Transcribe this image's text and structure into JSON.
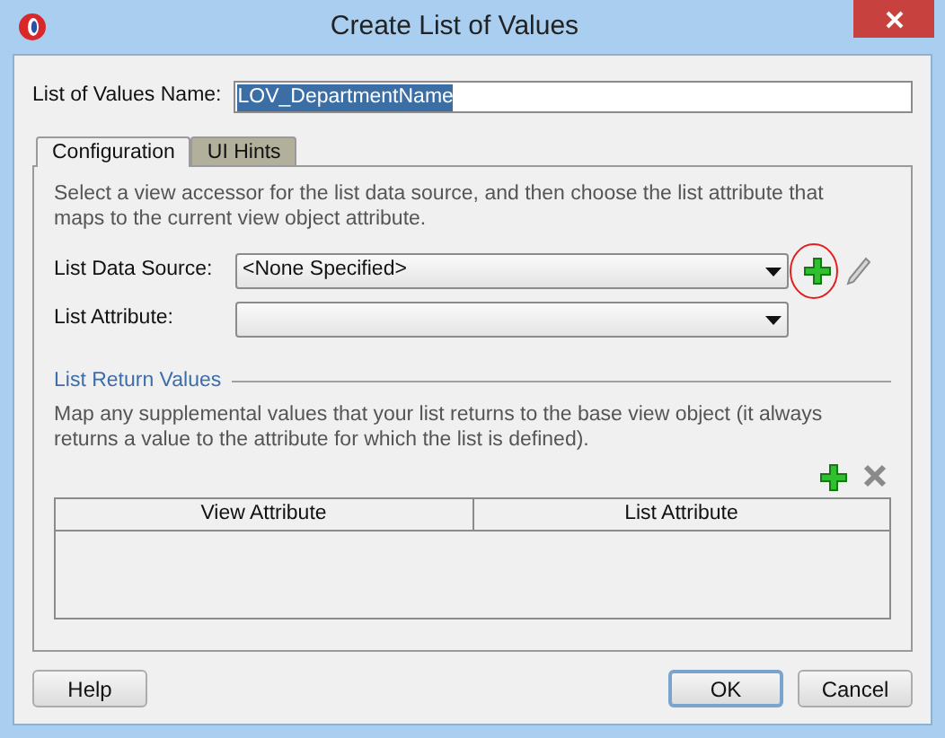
{
  "window": {
    "title": "Create List of Values"
  },
  "name_field": {
    "label": "List of Values Name:",
    "value": "LOV_DepartmentName"
  },
  "tabs": [
    {
      "label": "Configuration",
      "selected": true
    },
    {
      "label": "UI Hints",
      "selected": false
    }
  ],
  "description": "Select a view accessor for the list data source, and then choose the list attribute that maps to the current view object attribute.",
  "fields": [
    {
      "label": "List Data Source:",
      "value": "<None Specified>",
      "highlighted": true
    },
    {
      "label": "List Attribute:"
    }
  ],
  "return_values": {
    "title": "List Return Values",
    "description": "Map any supplemental values that your list returns to the base view object (it always returns a value to the attribute for which the list is defined).",
    "table": {
      "columns": [
        "View Attribute",
        "List Attribute"
      ]
    }
  },
  "buttons": [
    {
      "label": "Help",
      "default": false
    },
    {
      "label": "OK",
      "default": true
    },
    {
      "label": "Cancel",
      "default": false
    }
  ]
}
